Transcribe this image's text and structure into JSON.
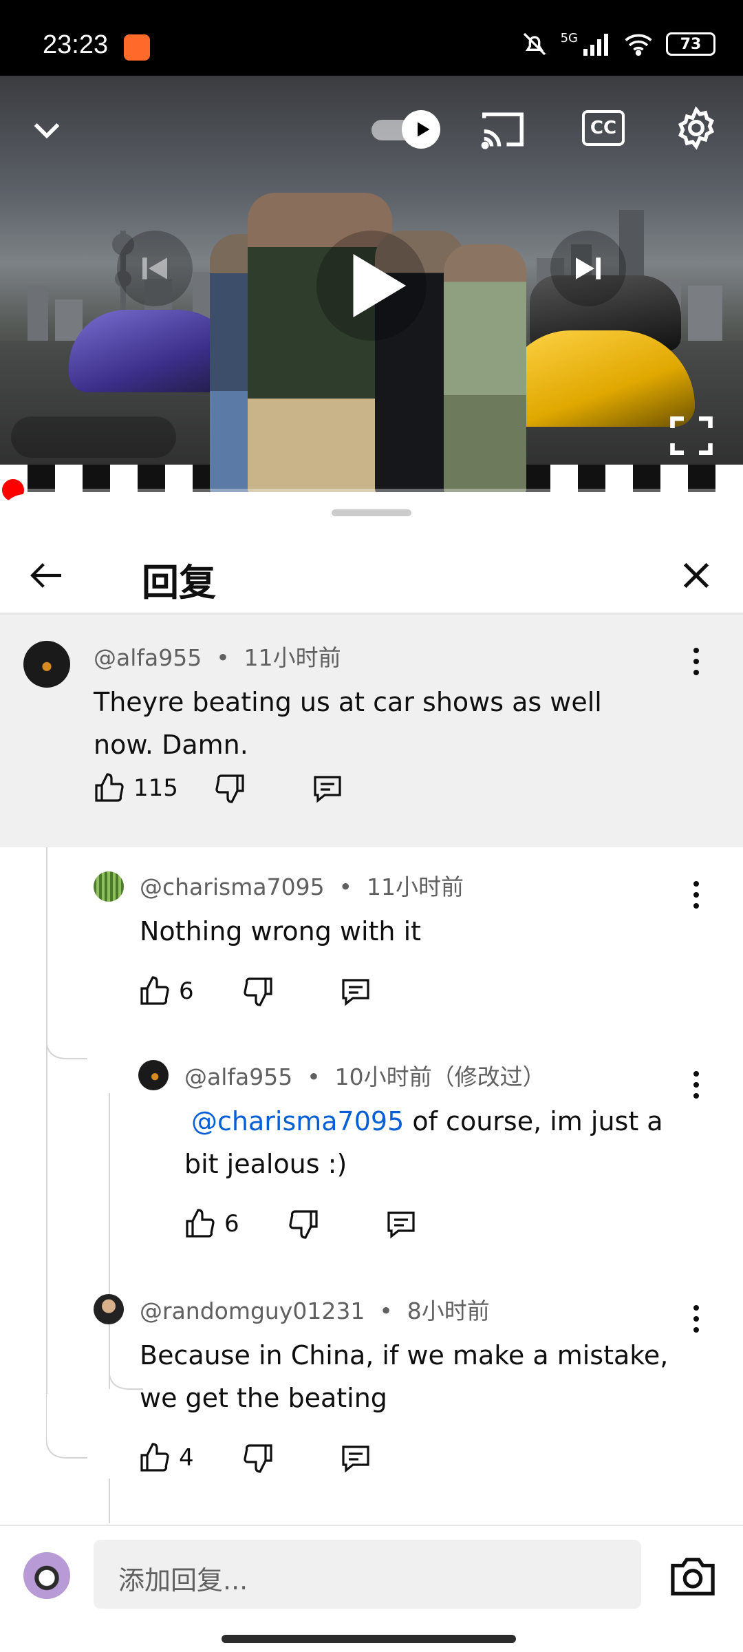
{
  "status_bar": {
    "time": "23:23",
    "battery": "73",
    "network": "5G"
  },
  "video": {
    "controls": [
      "collapse-icon",
      "autoplay-toggle",
      "cast-icon",
      "cc-icon",
      "settings-icon",
      "previous-icon",
      "play-icon",
      "next-icon",
      "fullscreen-icon"
    ],
    "progress": 0.0
  },
  "sheet": {
    "title": "回复"
  },
  "comments": [
    {
      "author": "@alfa955",
      "time": "11小时前",
      "text": "Theyre beating us at car shows as well now. Damn.",
      "likes": "115"
    },
    {
      "author": "@charisma7095",
      "time": "11小时前",
      "text": "Nothing wrong with it",
      "likes": "6"
    },
    {
      "author": "@alfa955",
      "time": "10小时前（修改过）",
      "mention": "@charisma7095",
      "text": " of course, im just a bit jealous :)",
      "likes": "6"
    },
    {
      "author": "@randomguy01231",
      "time": "8小时前",
      "text": "Because in China, if we make a mistake, we get the beating",
      "likes": "4"
    }
  ],
  "reply_box": {
    "placeholder": "添加回复..."
  },
  "colors": {
    "accent": "#065fd4",
    "progress": "#ff0000",
    "highlight_bg": "#f0f0f0"
  }
}
